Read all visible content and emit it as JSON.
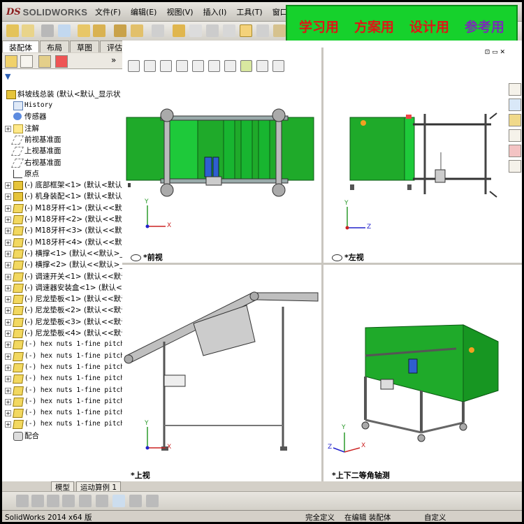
{
  "app": {
    "logo": "SOLIDWORKS",
    "menu": [
      "文件(F)",
      "编辑(E)",
      "视图(V)",
      "插入(I)",
      "工具(T)",
      "窗口(W)"
    ]
  },
  "banner": {
    "items": [
      "学习用",
      "方案用",
      "设计用",
      "参考用"
    ],
    "colors": {
      "background": "#16d12c",
      "text": "#e01515",
      "last": "#7a2ab8"
    }
  },
  "left_tabs": [
    "装配体",
    "布局",
    "草图",
    "评估"
  ],
  "tree": {
    "root": "斜坡线总装 (默认<默认_显示状",
    "items": [
      {
        "label": "History",
        "icon": "history-icon",
        "mono": true
      },
      {
        "label": "传感器",
        "icon": "sensor-icon"
      },
      {
        "label": "注解",
        "icon": "annotation-icon",
        "expand": true
      },
      {
        "label": "前视基准面",
        "icon": "plane-icon"
      },
      {
        "label": "上视基准面",
        "icon": "plane-icon"
      },
      {
        "label": "右视基准面",
        "icon": "plane-icon"
      },
      {
        "label": "原点",
        "icon": "origin-icon"
      },
      {
        "label": "(-) 底部框架<1> (默认<默认",
        "icon": "subassembly-icon",
        "expand": true
      },
      {
        "label": "(-) 机身装配<1> (默认<默认",
        "icon": "subassembly-icon",
        "expand": true
      },
      {
        "label": "(-) M18牙杆<1> (默认<<默认",
        "icon": "part-icon",
        "expand": true
      },
      {
        "label": "(-) M18牙杆<2> (默认<<默认",
        "icon": "part-icon",
        "expand": true
      },
      {
        "label": "(-) M18牙杆<3> (默认<<默认",
        "icon": "part-icon",
        "expand": true
      },
      {
        "label": "(-) M18牙杆<4> (默认<<默认",
        "icon": "part-icon",
        "expand": true
      },
      {
        "label": "(-) 横撑<1> (默认<<默认>_显",
        "icon": "part-icon",
        "expand": true
      },
      {
        "label": "(-) 横撑<2> (默认<<默认>_显",
        "icon": "part-icon",
        "expand": true
      },
      {
        "label": "(-) 调速开关<1> (默认<<默认",
        "icon": "part-icon",
        "expand": true
      },
      {
        "label": "(-) 调速器安装盒<1> (默认<",
        "icon": "part-icon",
        "expand": true
      },
      {
        "label": "(-) 尼龙垫板<1> (默认<<默认",
        "icon": "part-icon",
        "expand": true
      },
      {
        "label": "(-) 尼龙垫板<2> (默认<<默认",
        "icon": "part-icon",
        "expand": true
      },
      {
        "label": "(-) 尼龙垫板<3> (默认<<默认",
        "icon": "part-icon",
        "expand": true
      },
      {
        "label": "(-) 尼龙垫板<4> (默认<<默认",
        "icon": "part-icon",
        "expand": true
      },
      {
        "label": "(-) hex nuts 1-fine pitch",
        "icon": "part-icon",
        "expand": true,
        "mono": true
      },
      {
        "label": "(-) hex nuts 1-fine pitch",
        "icon": "part-icon",
        "expand": true,
        "mono": true
      },
      {
        "label": "(-) hex nuts 1-fine pitch",
        "icon": "part-icon",
        "expand": true,
        "mono": true
      },
      {
        "label": "(-) hex nuts 1-fine pitch",
        "icon": "part-icon",
        "expand": true,
        "mono": true
      },
      {
        "label": "(-) hex nuts 1-fine pitch",
        "icon": "part-icon",
        "expand": true,
        "mono": true
      },
      {
        "label": "(-) hex nuts 1-fine pitch",
        "icon": "part-icon",
        "expand": true,
        "mono": true
      },
      {
        "label": "(-) hex nuts 1-fine pitch",
        "icon": "part-icon",
        "expand": true,
        "mono": true
      },
      {
        "label": "(-) hex nuts 1-fine pitch",
        "icon": "part-icon",
        "expand": true,
        "mono": true
      },
      {
        "label": "配合",
        "icon": "mates-icon"
      }
    ]
  },
  "bottom_tabs": [
    "模型",
    "运动算例 1"
  ],
  "views": {
    "front": "*前视",
    "left": "*左视",
    "top": "*上视",
    "iso": "*上下二等角轴测"
  },
  "axis": {
    "x": "X",
    "y": "Y",
    "z": "Z"
  },
  "status": {
    "version": "SolidWorks 2014 x64 版",
    "defined": "完全定义",
    "editing": "在编辑 装配体",
    "custom": "自定义"
  }
}
